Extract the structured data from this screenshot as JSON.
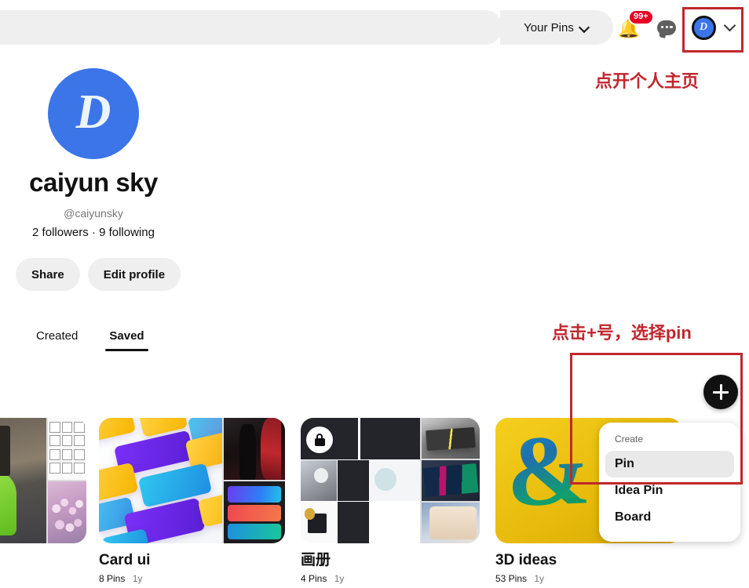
{
  "header": {
    "search_placeholder": "",
    "your_pins_label": "Your Pins",
    "notifications": {
      "icon": "bell-icon",
      "badge": "99+"
    },
    "messages": {
      "icon": "speech-bubble-icon"
    },
    "account": {
      "icon": "avatar-icon",
      "letter": "D",
      "chevron": "chevron-down-icon"
    }
  },
  "profile": {
    "avatar_letter": "D",
    "display_name": "caiyun sky",
    "handle": "@caiyunsky",
    "follow_stats": "2 followers · 9 following",
    "buttons": [
      {
        "label": "Share",
        "name": "share-button"
      },
      {
        "label": "Edit profile",
        "name": "edit-profile-button"
      }
    ]
  },
  "tabs": [
    {
      "label": "Created",
      "active": false
    },
    {
      "label": "Saved",
      "active": true
    }
  ],
  "boards": [
    {
      "title": "",
      "pins": "",
      "age": "",
      "secret": false,
      "partial": true
    },
    {
      "title": "Card ui",
      "pins": "8 Pins",
      "age": "1y",
      "secret": false,
      "partial": false
    },
    {
      "title": "画册",
      "pins": "4 Pins",
      "age": "1y",
      "secret": true,
      "partial": false
    },
    {
      "title": "3D ideas",
      "pins": "53 Pins",
      "age": "1y",
      "secret": false,
      "partial": false
    }
  ],
  "create": {
    "fab_icon": "plus-icon",
    "menu_header": "Create",
    "items": [
      {
        "label": "Pin",
        "highlighted": true
      },
      {
        "label": "Idea Pin",
        "highlighted": false
      },
      {
        "label": "Board",
        "highlighted": false
      }
    ]
  },
  "annotations": {
    "color": "#c0272d",
    "account_note": "点开个人主页",
    "create_note": "点击+号，选择pin"
  },
  "colors": {
    "accent_red": "#e60023",
    "annotation_red": "#c0272d",
    "chip_gray": "#efefef",
    "avatar_blue": "#3b75e8",
    "text_primary": "#111111",
    "text_secondary": "#767676",
    "fab_black": "#111111"
  }
}
